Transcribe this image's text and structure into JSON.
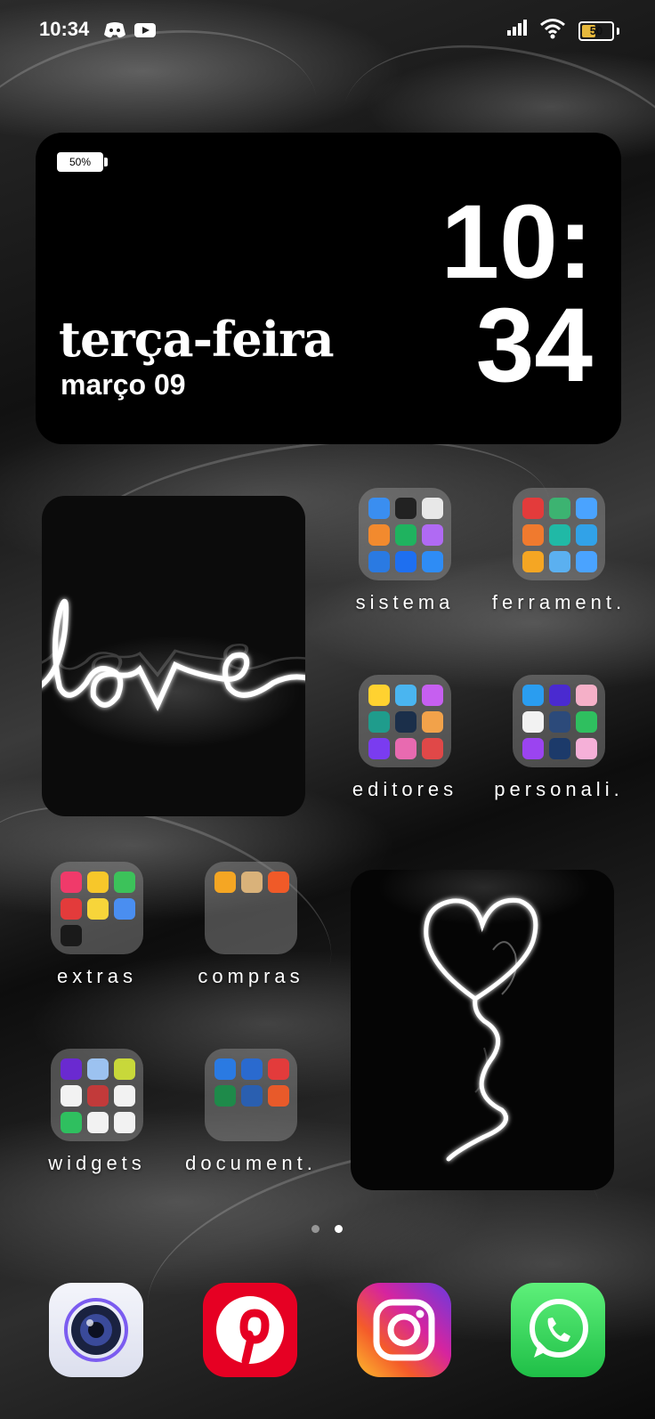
{
  "status_bar": {
    "time": "10:34",
    "battery": "50",
    "icons": [
      "discord-icon",
      "youtube-icon",
      "signal-icon",
      "wifi-icon",
      "battery-icon"
    ]
  },
  "clock_widget": {
    "battery": "50%",
    "weekday": "terça-feira",
    "date": "março 09",
    "hour": "10:",
    "minute": "34"
  },
  "folders": [
    {
      "label": "sistema",
      "colors": [
        "#3a8ef0",
        "#222",
        "#e8e8e8",
        "#f28a2e",
        "#1fb35f",
        "#b06af3",
        "#2a7ae2",
        "#1e6ff0",
        "#2e8cf5"
      ]
    },
    {
      "label": "ferrament.",
      "colors": [
        "#e33b3b",
        "#3cb371",
        "#4aa3ff",
        "#f07a2e",
        "#20b9a6",
        "#31a2e8",
        "#f5a623",
        "#5bb0f0",
        "#4aa3ff"
      ]
    },
    {
      "label": "editores",
      "colors": [
        "#ffd230",
        "#4ab5f0",
        "#c65ff0",
        "#1f9c8c",
        "#1b2f4a",
        "#f2a24a",
        "#7a3cf0",
        "#e86ab0",
        "#e04848"
      ]
    },
    {
      "label": "personali.",
      "colors": [
        "#2a9df0",
        "#4a2ad0",
        "#f5b0c8",
        "#f2f2f2",
        "#2c4a7a",
        "#2fbf5f",
        "#9b44f0",
        "#1c3a6a",
        "#f5b0d8"
      ]
    },
    {
      "label": "extras",
      "colors": [
        "#f03a6a",
        "#f7c72a",
        "#3cc25a",
        "#e33b3b",
        "#f7d53a",
        "#4a8ef0",
        "#1a1a1a"
      ]
    },
    {
      "label": "compras",
      "colors": [
        "#f5a623",
        "#d9b27a",
        "#f05a28"
      ]
    },
    {
      "label": "widgets",
      "colors": [
        "#6a2ad0",
        "#9cc2f0",
        "#c8d83a",
        "#f2f2f2",
        "#c23a3a",
        "#f2f2f2",
        "#2fbf5f",
        "#f2f2f2",
        "#f2f2f2"
      ]
    },
    {
      "label": "document.",
      "colors": [
        "#2a7ae2",
        "#2a6acf",
        "#e33b3b",
        "#1e8a4a",
        "#2a5fb0",
        "#e85a2a"
      ]
    }
  ],
  "images": {
    "love_text": "love"
  },
  "dock": [
    {
      "name": "camera-app-icon",
      "color": "#e8eaf5"
    },
    {
      "name": "pinterest-app-icon",
      "color": "#e60023"
    },
    {
      "name": "instagram-app-icon",
      "color": "#d6249f"
    },
    {
      "name": "whatsapp-app-icon",
      "color": "#25d366"
    }
  ],
  "page_indicator": {
    "pages": 2,
    "current": 2
  }
}
